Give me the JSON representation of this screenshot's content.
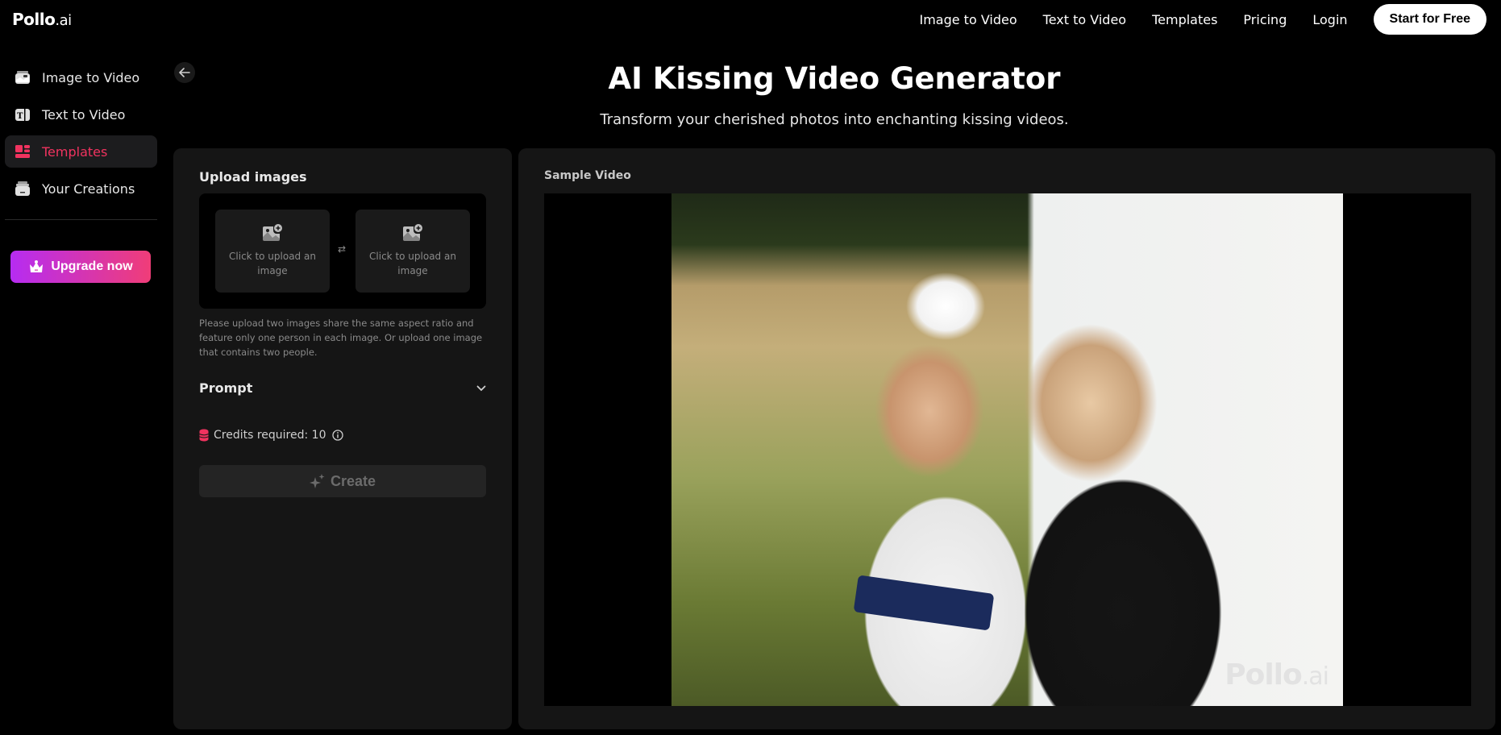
{
  "brand": {
    "name": "Pollo",
    "suffix": ".ai"
  },
  "topnav": {
    "links": [
      "Image to Video",
      "Text to Video",
      "Templates",
      "Pricing",
      "Login"
    ],
    "cta": "Start for Free"
  },
  "sidebar": {
    "items": [
      {
        "label": "Image to Video",
        "icon": "image-to-video-icon",
        "active": false
      },
      {
        "label": "Text to Video",
        "icon": "text-to-video-icon",
        "active": false
      },
      {
        "label": "Templates",
        "icon": "templates-icon",
        "active": true
      },
      {
        "label": "Your Creations",
        "icon": "creations-icon",
        "active": false
      }
    ],
    "upgrade_label": "Upgrade now"
  },
  "header": {
    "title": "AI Kissing Video Generator",
    "subtitle": "Transform your cherished photos into enchanting kissing videos."
  },
  "form": {
    "upload_title": "Upload images",
    "slot_label": "Click to upload an image",
    "swap_glyph": "⇄",
    "hint": "Please upload two images share the same aspect ratio and feature only one person in each image. Or upload one image that contains two people.",
    "prompt_label": "Prompt",
    "credits_label": "Credits required: 10",
    "create_label": "Create"
  },
  "preview": {
    "title": "Sample Video",
    "watermark_name": "Pollo",
    "watermark_suffix": ".ai"
  },
  "colors": {
    "accent": "#f0335f",
    "upgrade_gradient_start": "#b62cf2",
    "upgrade_gradient_end": "#f03d78",
    "panel_bg": "#151515"
  }
}
